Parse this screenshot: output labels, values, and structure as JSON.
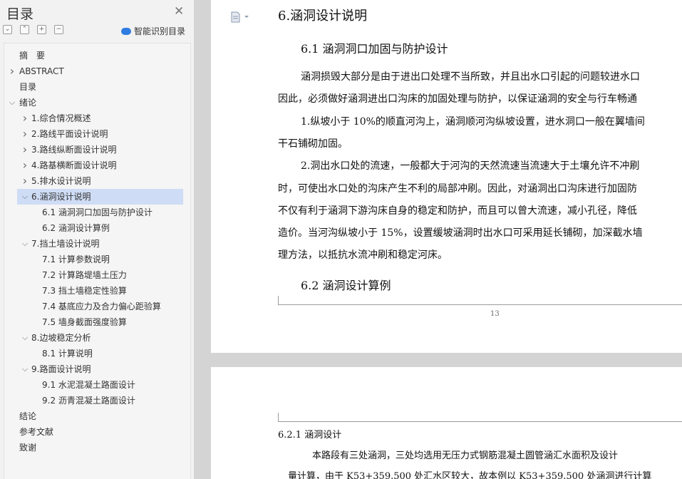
{
  "sidebar": {
    "title": "目录",
    "ai_label": "智能识别目录",
    "items": [
      {
        "label": "摘　要",
        "level": 0,
        "caret": "",
        "selected": false
      },
      {
        "label": "ABSTRACT",
        "level": 0,
        "caret": "right",
        "selected": false
      },
      {
        "label": "目录",
        "level": 0,
        "caret": "",
        "selected": false
      },
      {
        "label": "绪论",
        "level": 0,
        "caret": "down",
        "selected": false
      },
      {
        "label": "1.综合情况概述",
        "level": 1,
        "caret": "right",
        "selected": false
      },
      {
        "label": "2.路线平面设计说明",
        "level": 1,
        "caret": "right",
        "selected": false
      },
      {
        "label": "3.路线纵断面设计说明",
        "level": 1,
        "caret": "right",
        "selected": false
      },
      {
        "label": "4.路基横断面设计说明",
        "level": 1,
        "caret": "right",
        "selected": false
      },
      {
        "label": "5.排水设计说明",
        "level": 1,
        "caret": "right",
        "selected": false
      },
      {
        "label": "6.涵洞设计说明",
        "level": 1,
        "caret": "down",
        "selected": true
      },
      {
        "label": "6.1  涵洞洞口加固与防护设计",
        "level": 2,
        "caret": "",
        "selected": false
      },
      {
        "label": "6.2  涵洞设计算例",
        "level": 2,
        "caret": "",
        "selected": false
      },
      {
        "label": "7.挡土墙设计说明",
        "level": 1,
        "caret": "down",
        "selected": false
      },
      {
        "label": "7.1  计算参数说明",
        "level": 2,
        "caret": "",
        "selected": false
      },
      {
        "label": "7.2  计算路堤墙土压力",
        "level": 2,
        "caret": "",
        "selected": false
      },
      {
        "label": "7.3  挡土墙稳定性验算",
        "level": 2,
        "caret": "",
        "selected": false
      },
      {
        "label": "7.4  基底应力及合力偏心距验算",
        "level": 2,
        "caret": "",
        "selected": false
      },
      {
        "label": "7.5  墙身截面强度验算",
        "level": 2,
        "caret": "",
        "selected": false
      },
      {
        "label": "8.边坡稳定分析",
        "level": 1,
        "caret": "down",
        "selected": false
      },
      {
        "label": "8.1 计算说明",
        "level": 2,
        "caret": "",
        "selected": false
      },
      {
        "label": "9.路面设计说明",
        "level": 1,
        "caret": "down",
        "selected": false
      },
      {
        "label": "9.1  水泥混凝土路面设计",
        "level": 2,
        "caret": "",
        "selected": false
      },
      {
        "label": "9.2  沥青混凝土路面设计",
        "level": 2,
        "caret": "",
        "selected": false
      },
      {
        "label": "结论",
        "level": 0,
        "caret": "",
        "selected": false
      },
      {
        "label": "参考文献",
        "level": 0,
        "caret": "",
        "selected": false
      },
      {
        "label": "致谢",
        "level": 0,
        "caret": "",
        "selected": false
      }
    ]
  },
  "icons": {
    "close": "close-icon",
    "collapse_all": "collapse-icon",
    "expand_all": "expand-icon",
    "add": "plus-icon",
    "remove": "minus-icon",
    "ai": "cloud-icon",
    "bookmark": "page-icon"
  },
  "doc": {
    "heading1": "6.涵洞设计说明",
    "sec61": "6.1  涵洞洞口加固与防护设计",
    "para1_line1": "涵洞损毁大部分是由于进出口处理不当所致，并且出水口引起的问题较进水口",
    "para1_line2": "因此，必须做好涵洞进出口沟床的加固处理与防护，以保证涵洞的安全与行车畅通",
    "para2_line1": "1.纵坡小于 10%的顺直河沟上，涵洞顺河沟纵坡设置，进水洞口一般在翼墙间",
    "para2_line2": "干石铺砌加固。",
    "para3_line1": "2.洞出水口处的流速，一般都大于河沟的天然流速当流速大于土壤允许不冲刷",
    "para3_line2": "时，可使出水口处的沟床产生不利的局部冲刷。因此，对涵洞出口沟床进行加固防",
    "para3_line3": "不仅有利于涵洞下游沟床自身的稳定和防护，而且可以曾大流速，减小孔径，降低",
    "para3_line4": "造价。当河沟纵坡小于 15%，设置缓坡涵洞时出水口可采用延长铺砌，加深截水墙",
    "para3_line5": "理方法，以抵抗水流冲刷和稳定河床。",
    "sec62": "6.2  涵洞设计算例",
    "page_number": "13",
    "sec621": "6.2.1  涵洞设计",
    "para4_line1": "本路段有三处涵洞，三处均选用无压力式钢筋混凝土圆管涵汇水面积及设计",
    "para4_line2": "量计算，由于 K53+359.500 处汇水区较大，故本例以 K53+359.500 处涵洞进行计算"
  },
  "colors": {
    "sidebar_bg": "#f2f2f2",
    "selected_bg": "#cfdcf5",
    "accent": "#2f7de1",
    "doc_bg": "#d4d4d4"
  }
}
